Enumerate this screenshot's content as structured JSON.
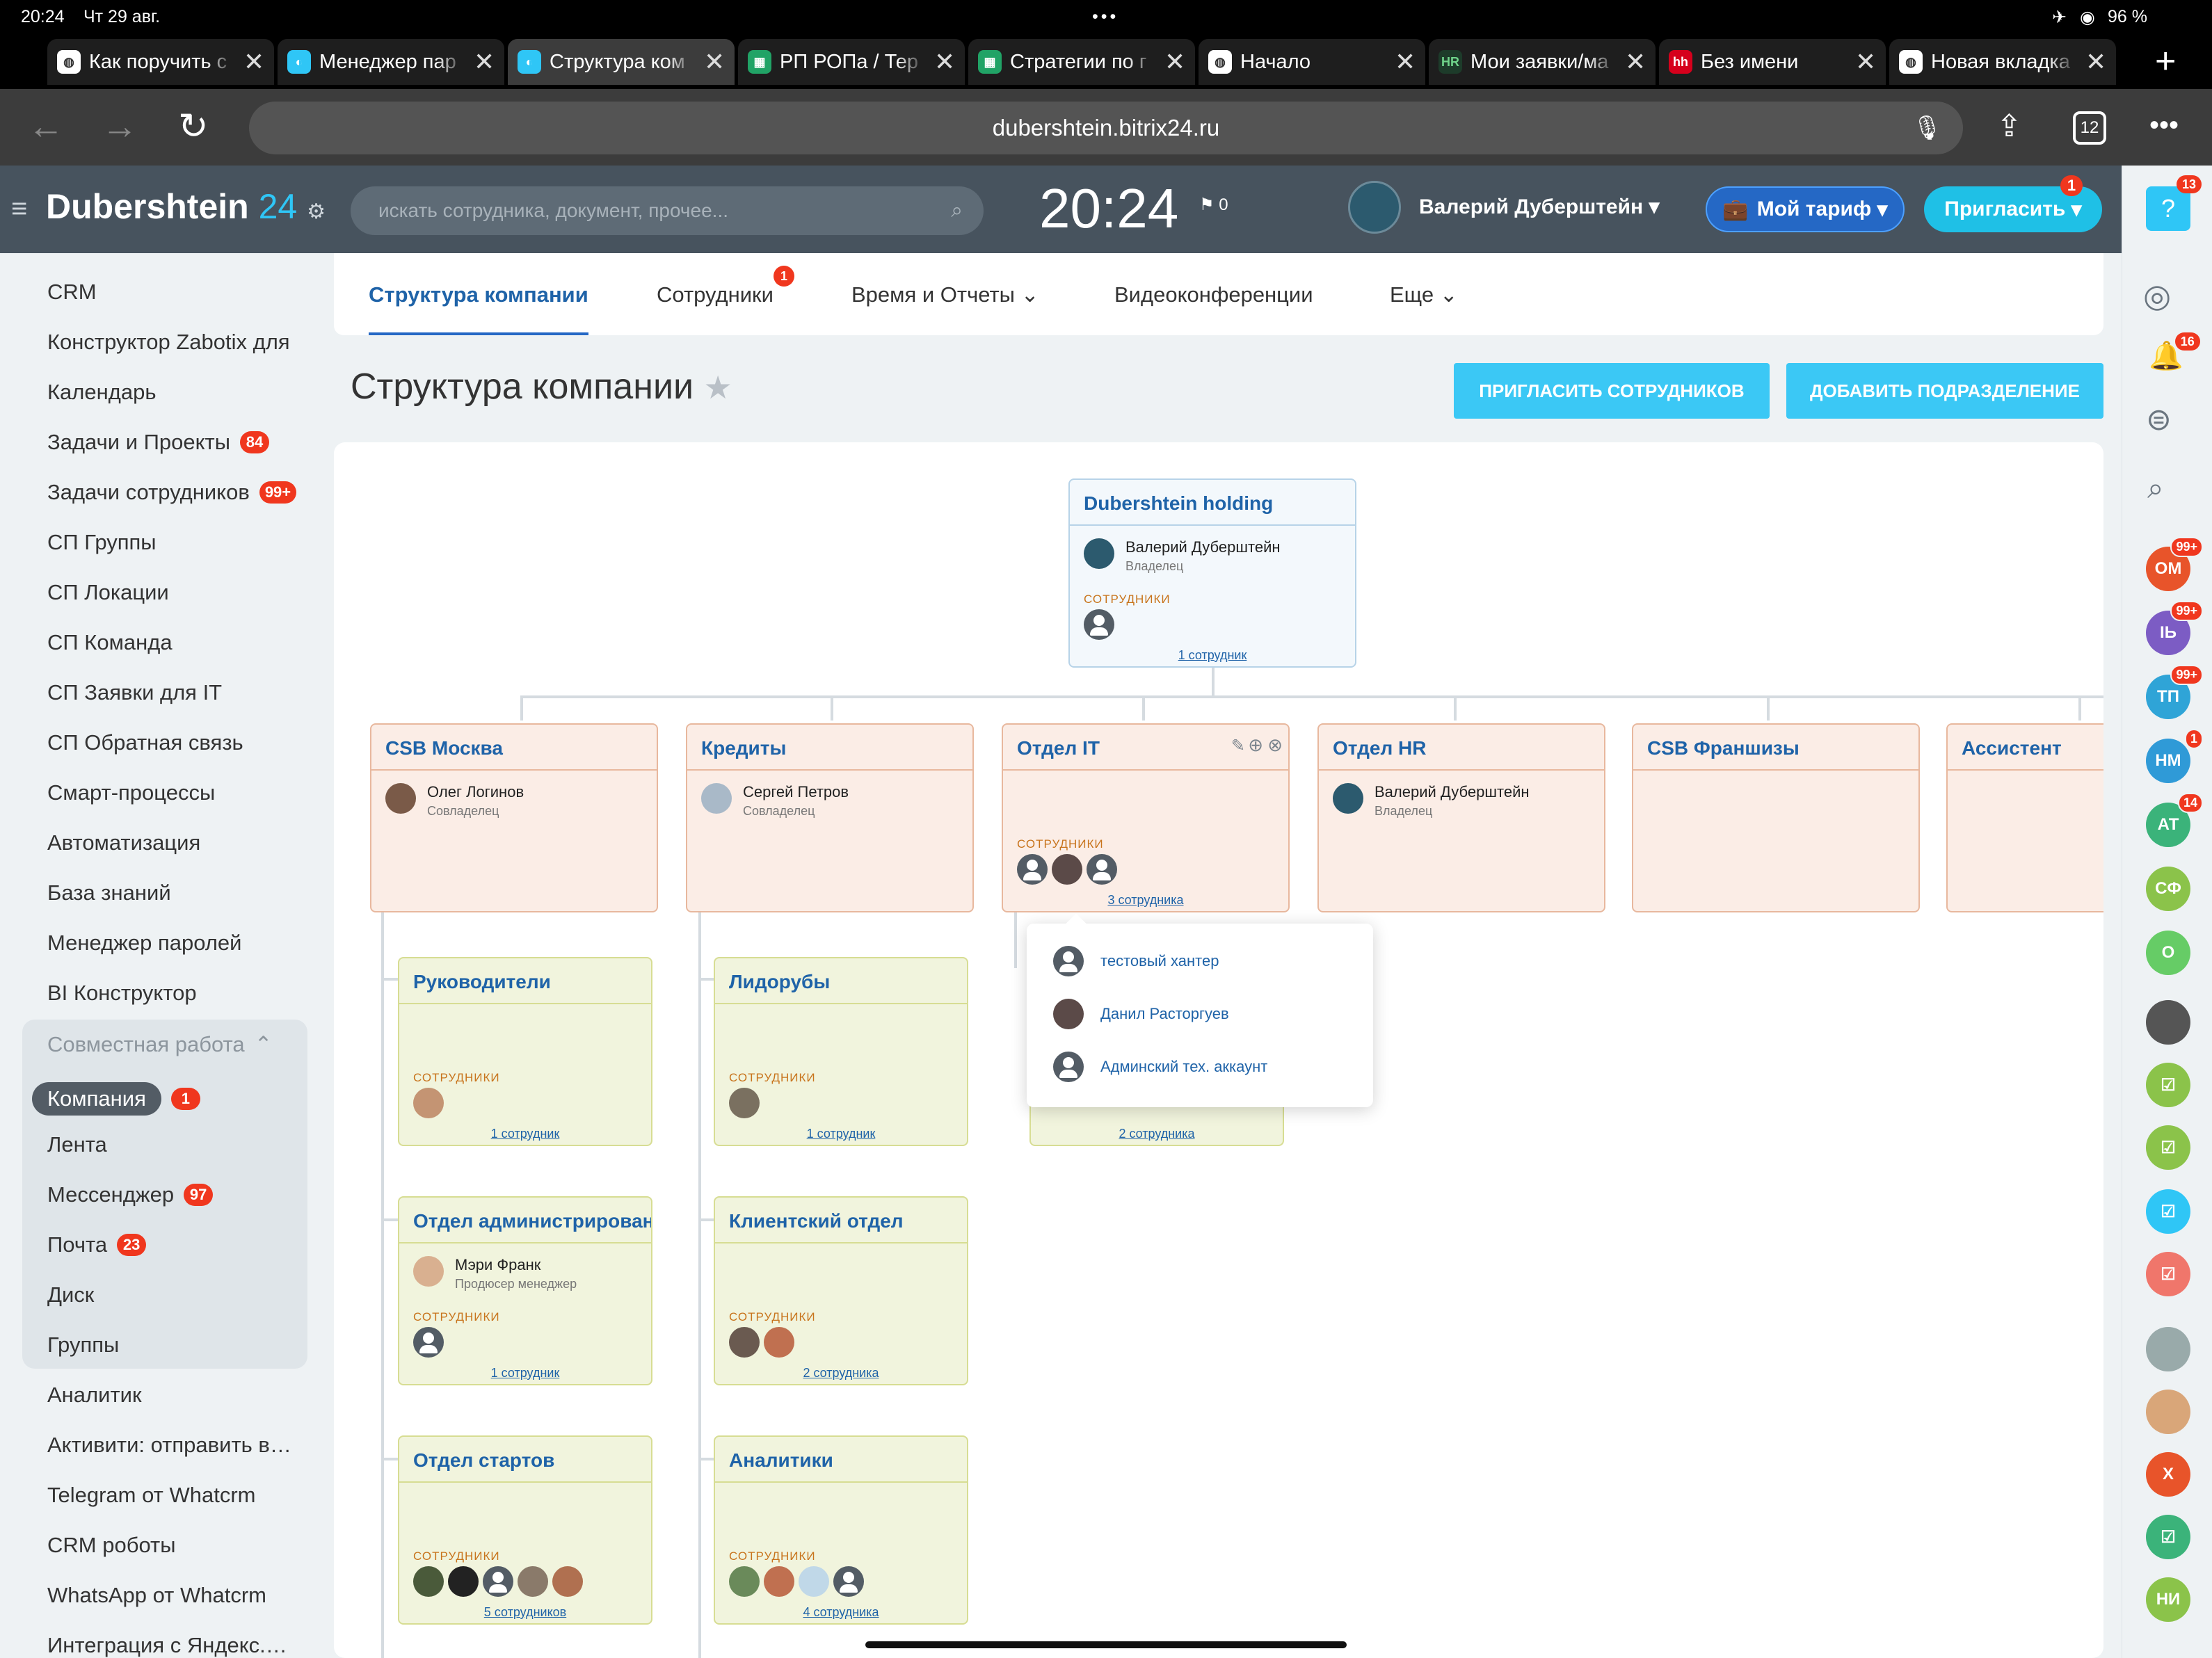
{
  "status": {
    "time": "20:24",
    "date": "Чт 29 авг.",
    "battery": "96 %"
  },
  "browser": {
    "tabs": [
      {
        "label": "Как поручить с",
        "icon": "globe-icon",
        "active": false
      },
      {
        "label": "Менеджер пар",
        "icon": "bitrix-icon",
        "active": false
      },
      {
        "label": "Структура ком",
        "icon": "bitrix-icon",
        "active": true
      },
      {
        "label": "РП РОПа / Тер",
        "icon": "sheets-icon",
        "active": false
      },
      {
        "label": "Стратегии по г",
        "icon": "sheets-icon",
        "active": false
      },
      {
        "label": "Начало",
        "icon": "globe-icon",
        "active": false
      },
      {
        "label": "Мои заявки/ма",
        "icon": "hr-icon",
        "active": false
      },
      {
        "label": "Без имени",
        "icon": "hh-icon",
        "active": false
      },
      {
        "label": "Новая вкладка",
        "icon": "globe-icon",
        "active": false
      }
    ],
    "url": "dubershtein.bitrix24.ru",
    "tab_count": "12"
  },
  "header": {
    "logo": "Dubershtein",
    "logo_num": "24",
    "search_placeholder": "искать сотрудника, документ, прочее...",
    "clock": "20:24",
    "flag_count": "0",
    "user_name": "Валерий Дуберштейн",
    "tariff_label": "Мой тариф",
    "invite_label": "Пригласить",
    "invite_badge": "1",
    "help_badge": "13"
  },
  "sidebar": {
    "items": [
      {
        "label": "CRM"
      },
      {
        "label": "Конструктор Zabotix для"
      },
      {
        "label": "Календарь"
      },
      {
        "label": "Задачи и Проекты",
        "badge": "84"
      },
      {
        "label": "Задачи сотрудников",
        "badge": "99+"
      },
      {
        "label": "СП Группы"
      },
      {
        "label": "СП Локации"
      },
      {
        "label": "СП Команда"
      },
      {
        "label": "СП Заявки для IT"
      },
      {
        "label": "СП Обратная связь"
      },
      {
        "label": "Смарт-процессы"
      },
      {
        "label": "Автоматизация"
      },
      {
        "label": "База знаний"
      },
      {
        "label": "Менеджер паролей"
      },
      {
        "label": "BI Конструктор"
      }
    ],
    "group_title": "Совместная работа",
    "group_items": [
      {
        "label": "Компания",
        "badge": "1"
      },
      {
        "label": "Лента"
      },
      {
        "label": "Мессенджер",
        "badge": "97"
      },
      {
        "label": "Почта",
        "badge": "23"
      },
      {
        "label": "Диск"
      },
      {
        "label": "Группы"
      }
    ],
    "after": [
      {
        "label": "Аналитик"
      },
      {
        "label": "Активити: отправить в чат"
      },
      {
        "label": "Telegram от Whatcrm"
      },
      {
        "label": "CRM роботы"
      },
      {
        "label": "WhatsApp от Whatcrm"
      },
      {
        "label": "Интеграция с Яндекс.Директ"
      }
    ]
  },
  "nav": {
    "tabs": [
      "Структура компании",
      "Сотрудники",
      "Время и Отчеты",
      "Видеоконференции",
      "Еще"
    ],
    "employees_badge": "1"
  },
  "page": {
    "title": "Структура компании",
    "invite_btn": "ПРИГЛАСИТЬ СОТРУДНИКОВ",
    "add_btn": "ДОБАВИТЬ ПОДРАЗДЕЛЕНИЕ"
  },
  "org": {
    "root": {
      "name": "Dubershtein holding",
      "head": "Валерий Дуберштейн",
      "role": "Владелец",
      "emp_label": "СОТРУДНИКИ",
      "count": "1 сотрудник"
    },
    "depts": [
      {
        "name": "CSB Москва",
        "head": "Олег Логинов",
        "role": "Совладелец"
      },
      {
        "name": "Кредиты",
        "head": "Сергей Петров",
        "role": "Совладелец"
      },
      {
        "name": "Отдел IT",
        "emp_label": "СОТРУДНИКИ",
        "count": "3 сотрудника"
      },
      {
        "name": "Отдел HR",
        "head": "Валерий Дуберштейн",
        "role": "Владелец"
      },
      {
        "name": "CSB Франшизы"
      },
      {
        "name": "Ассистент"
      }
    ],
    "sub_col1": [
      {
        "name": "Руководители",
        "emp_label": "СОТРУДНИКИ",
        "count": "1 сотрудник"
      },
      {
        "name": "Отдел администрирования",
        "head": "Мэри Франк",
        "role": "Продюсер менеджер",
        "emp_label": "СОТРУДНИКИ",
        "count": "1 сотрудник"
      },
      {
        "name": "Отдел стартов",
        "emp_label": "СОТРУДНИКИ",
        "count": "5 сотрудников"
      }
    ],
    "sub_col2": [
      {
        "name": "Лидорубы",
        "emp_label": "СОТРУДНИКИ",
        "count": "1 сотрудник"
      },
      {
        "name": "Клиентский отдел",
        "emp_label": "СОТРУДНИКИ",
        "count": "2 сотрудника"
      },
      {
        "name": "Аналитики",
        "emp_label": "СОТРУДНИКИ",
        "count": "4 сотрудника"
      }
    ],
    "sub_col3_count": "2 сотрудника",
    "popup": [
      "тестовый хантер",
      "Данил Расторгуев",
      "Админский тех. аккаунт"
    ]
  },
  "rightbar": [
    {
      "label": "ОМ",
      "color": "#e8542a",
      "badge": "99+"
    },
    {
      "label": "ІЬ",
      "color": "#7c5cc4",
      "badge": "99+"
    },
    {
      "label": "ТП",
      "color": "#2fa4d7",
      "badge": "99+"
    },
    {
      "label": "НМ",
      "color": "#2f9ad7",
      "badge": "1"
    },
    {
      "label": "АТ",
      "color": "#3bb37a",
      "badge": "14"
    },
    {
      "label": "СФ",
      "color": "#8bc34a"
    },
    {
      "label": "О",
      "color": "#66cc66"
    }
  ],
  "notif_badge": "16"
}
